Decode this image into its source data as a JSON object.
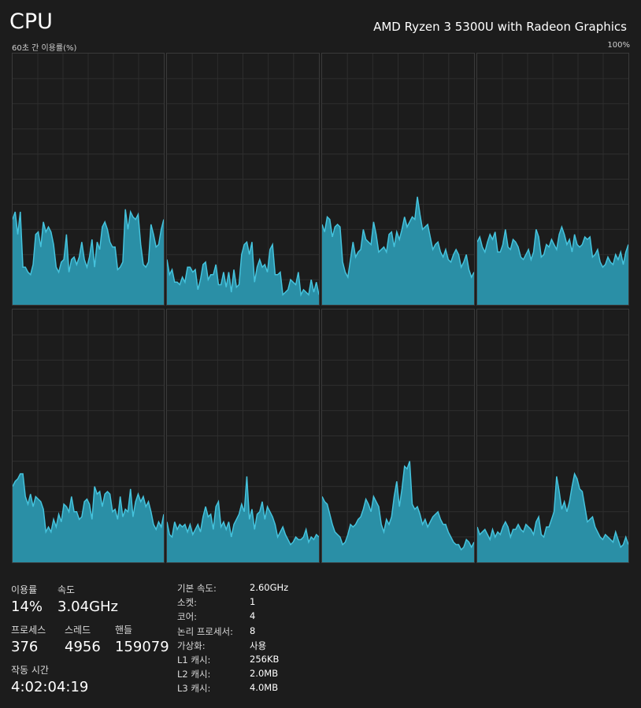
{
  "header": {
    "title": "CPU",
    "cpu_name": "AMD Ryzen 3 5300U with Radeon Graphics",
    "graph_caption": "60초 간 이용률(%)",
    "graph_max": "100%"
  },
  "colors": {
    "background": "#1c1c1c",
    "graph_fill": "#2a8fa6",
    "graph_line": "#45c3dd",
    "grid_line": "#2e2e2e",
    "border": "#3a3a3a"
  },
  "graphs": [
    {
      "name": "core-0",
      "values": [
        34,
        37,
        28,
        37,
        15,
        15,
        13,
        12,
        16,
        28,
        29,
        23,
        33,
        29,
        31,
        29,
        24,
        15,
        13,
        17,
        18,
        28,
        13,
        18,
        19,
        16,
        19,
        25,
        18,
        15,
        19,
        26,
        15,
        25,
        22,
        31,
        33,
        30,
        25,
        23,
        23,
        14,
        15,
        17,
        38,
        30,
        37,
        35,
        34,
        36,
        24,
        16,
        15,
        17,
        32,
        28,
        23,
        24,
        30,
        34
      ]
    },
    {
      "name": "core-1",
      "values": [
        18,
        12,
        14,
        9,
        9,
        8,
        11,
        9,
        15,
        15,
        13,
        14,
        6,
        10,
        16,
        17,
        10,
        12,
        12,
        16,
        8,
        8,
        13,
        7,
        13,
        5,
        14,
        7,
        8,
        20,
        24,
        25,
        20,
        25,
        9,
        15,
        18,
        15,
        16,
        13,
        22,
        24,
        12,
        12,
        13,
        4,
        5,
        6,
        10,
        9,
        8,
        13,
        4,
        6,
        5,
        4,
        10,
        5,
        9,
        4
      ]
    },
    {
      "name": "core-2",
      "values": [
        32,
        29,
        35,
        34,
        27,
        31,
        32,
        31,
        17,
        13,
        11,
        18,
        25,
        19,
        21,
        22,
        30,
        26,
        25,
        24,
        33,
        28,
        21,
        22,
        23,
        21,
        28,
        29,
        23,
        29,
        26,
        30,
        35,
        31,
        33,
        35,
        34,
        43,
        36,
        30,
        31,
        32,
        27,
        22,
        24,
        25,
        21,
        19,
        22,
        18,
        17,
        20,
        22,
        20,
        15,
        17,
        20,
        14,
        11,
        13
      ]
    },
    {
      "name": "core-3",
      "values": [
        25,
        27,
        23,
        21,
        25,
        28,
        26,
        29,
        21,
        21,
        24,
        30,
        23,
        22,
        26,
        25,
        23,
        19,
        18,
        20,
        22,
        18,
        21,
        30,
        27,
        19,
        20,
        24,
        23,
        26,
        24,
        22,
        28,
        31,
        28,
        24,
        26,
        21,
        28,
        24,
        23,
        24,
        27,
        26,
        27,
        19,
        20,
        22,
        17,
        15,
        16,
        19,
        17,
        16,
        20,
        18,
        21,
        16,
        21,
        24
      ]
    },
    {
      "name": "core-4",
      "values": [
        30,
        32,
        33,
        35,
        35,
        26,
        23,
        27,
        22,
        26,
        25,
        24,
        21,
        12,
        14,
        12,
        17,
        14,
        19,
        16,
        23,
        22,
        20,
        26,
        20,
        20,
        17,
        18,
        24,
        25,
        23,
        17,
        30,
        27,
        28,
        22,
        27,
        28,
        27,
        20,
        21,
        17,
        26,
        18,
        21,
        20,
        29,
        18,
        24,
        27,
        24,
        26,
        22,
        24,
        20,
        15,
        13,
        16,
        14,
        19
      ]
    },
    {
      "name": "core-5",
      "values": [
        16,
        11,
        10,
        16,
        13,
        15,
        14,
        15,
        12,
        15,
        11,
        13,
        15,
        12,
        18,
        22,
        18,
        19,
        13,
        22,
        24,
        14,
        16,
        13,
        16,
        10,
        15,
        17,
        19,
        23,
        20,
        34,
        17,
        21,
        13,
        19,
        20,
        24,
        17,
        22,
        20,
        18,
        15,
        10,
        12,
        14,
        11,
        9,
        7,
        8,
        10,
        9,
        9,
        10,
        13,
        8,
        10,
        9,
        11,
        10
      ]
    },
    {
      "name": "core-6",
      "values": [
        26,
        24,
        23,
        19,
        15,
        12,
        11,
        10,
        7,
        8,
        11,
        15,
        14,
        15,
        17,
        18,
        21,
        25,
        23,
        20,
        26,
        24,
        22,
        15,
        12,
        17,
        15,
        18,
        26,
        32,
        22,
        29,
        38,
        37,
        40,
        23,
        21,
        22,
        19,
        15,
        17,
        14,
        16,
        18,
        19,
        20,
        17,
        15,
        15,
        12,
        10,
        8,
        7,
        7,
        5,
        6,
        9,
        8,
        6,
        8
      ]
    },
    {
      "name": "core-7",
      "values": [
        14,
        11,
        12,
        13,
        11,
        9,
        13,
        10,
        12,
        11,
        14,
        16,
        14,
        10,
        13,
        13,
        15,
        13,
        12,
        15,
        14,
        13,
        11,
        16,
        18,
        11,
        10,
        14,
        14,
        17,
        20,
        34,
        28,
        21,
        24,
        20,
        24,
        30,
        35,
        33,
        29,
        28,
        22,
        16,
        17,
        18,
        14,
        12,
        10,
        9,
        11,
        10,
        9,
        8,
        12,
        9,
        6,
        7,
        10,
        7
      ]
    }
  ],
  "stats": {
    "utilization_label": "이용률",
    "utilization_value": "14%",
    "speed_label": "속도",
    "speed_value": "3.04GHz",
    "processes_label": "프로세스",
    "processes_value": "376",
    "threads_label": "스레드",
    "threads_value": "4956",
    "handles_label": "핸들",
    "handles_value": "159079",
    "uptime_label": "작동 시간",
    "uptime_value": "4:02:04:19"
  },
  "specs": [
    {
      "key": "기본 속도:",
      "value": "2.60GHz"
    },
    {
      "key": "소켓:",
      "value": "1"
    },
    {
      "key": "코어:",
      "value": "4"
    },
    {
      "key": "논리 프로세서:",
      "value": "8"
    },
    {
      "key": "가상화:",
      "value": "사용"
    },
    {
      "key": "L1 캐시:",
      "value": "256KB"
    },
    {
      "key": "L2 캐시:",
      "value": "2.0MB"
    },
    {
      "key": "L3 캐시:",
      "value": "4.0MB"
    }
  ]
}
